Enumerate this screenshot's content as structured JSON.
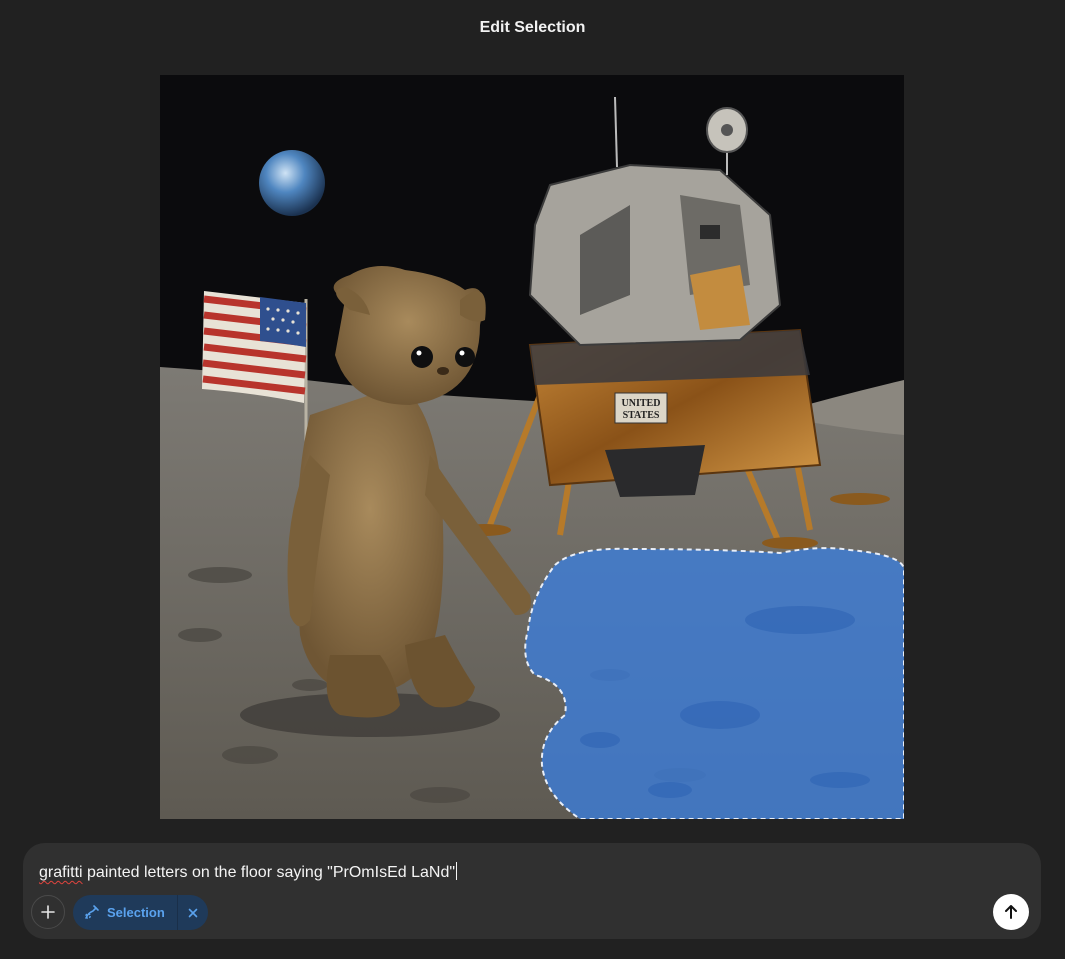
{
  "header": {
    "title": "Edit Selection"
  },
  "canvas": {
    "flag_text_line1": "UNITED",
    "flag_text_line2": "STATES",
    "selection_color": "#3b7ddd"
  },
  "composer": {
    "prompt_misspelled": "grafitti",
    "prompt_rest": " painted letters on the floor saying \"PrOmIsEd LaNd\"",
    "add_icon": "plus-icon",
    "chip": {
      "label": "Selection",
      "icon": "selection-brush-icon",
      "close_icon": "close-icon"
    },
    "send_icon": "arrow-up-icon"
  },
  "colors": {
    "background": "#212121",
    "composer": "#303030",
    "chip_bg": "#1f3a5a",
    "chip_text": "#5aa2ee"
  }
}
